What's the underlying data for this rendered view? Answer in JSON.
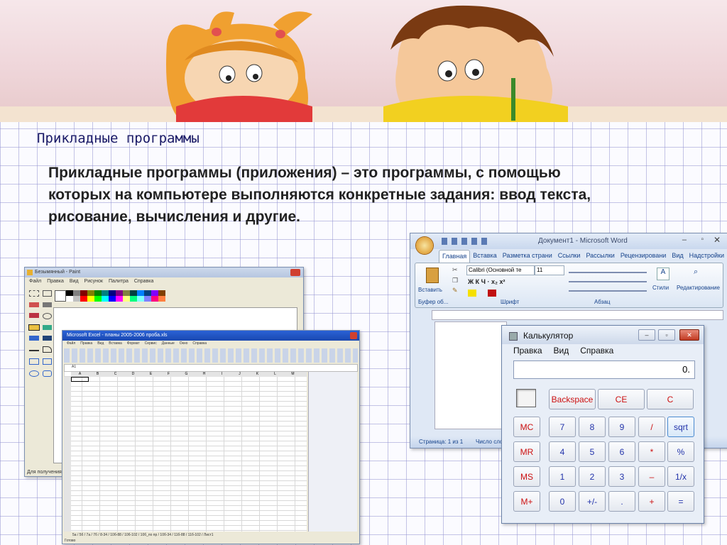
{
  "slide": {
    "title": "Прикладные программы",
    "body": "Прикладные программы (приложения) – это программы, с помощью которых на компьютере выполняются конкретные задания: ввод текста, рисование, вычисления и другие."
  },
  "paint": {
    "title": "Безымянный - Paint",
    "menu": [
      "Файл",
      "Правка",
      "Вид",
      "Рисунок",
      "Палитра",
      "Справка"
    ],
    "status": "Для получения"
  },
  "excel": {
    "title": "Microsoft Excel - планы 2005-2006 проба.xls",
    "menu": [
      "Файл",
      "Правка",
      "Вид",
      "Вставка",
      "Формат",
      "Сервис",
      "Данные",
      "Окно",
      "Справка"
    ],
    "name_box": "A1",
    "columns": [
      "A",
      "B",
      "C",
      "D",
      "E",
      "F",
      "G",
      "H",
      "I",
      "J",
      "K",
      "L",
      "M",
      "N"
    ],
    "sheet_tabs": "5а / 5б / 7а / 7б / 8-34 / 10б-88 / 10б-102 / 10б_по пр / 10б-34 / 11б-88 / 11б-102 / Лист1",
    "status": "Готово"
  },
  "word": {
    "title": "Документ1 - Microsoft Word",
    "tabs": [
      "Главная",
      "Вставка",
      "Разметка страни",
      "Ссылки",
      "Рассылки",
      "Рецензировани",
      "Вид",
      "Надстройки"
    ],
    "paste_label": "Вставить",
    "clipboard_label": "Буфер об...",
    "font_group_label": "Шрифт",
    "paragraph_group_label": "Абзац",
    "font_name": "Calibri (Основной те",
    "font_size": "11",
    "styles_label": "Стили",
    "editing_label": "Редактирование",
    "status_page": "Страница: 1 из 1",
    "status_words": "Число сло"
  },
  "calculator": {
    "title": "Калькулятор",
    "menu": [
      "Правка",
      "Вид",
      "Справка"
    ],
    "display": "0.",
    "top_buttons": [
      "Backspace",
      "CE",
      "C"
    ],
    "rows": [
      [
        "MC",
        "7",
        "8",
        "9",
        "/",
        "sqrt"
      ],
      [
        "MR",
        "4",
        "5",
        "6",
        "*",
        "%"
      ],
      [
        "MS",
        "1",
        "2",
        "3",
        "–",
        "1/x"
      ],
      [
        "M+",
        "0",
        "+/-",
        ".",
        "+",
        "="
      ]
    ],
    "colors": {
      "red": "#cc1111",
      "blue": "#2233aa"
    }
  }
}
